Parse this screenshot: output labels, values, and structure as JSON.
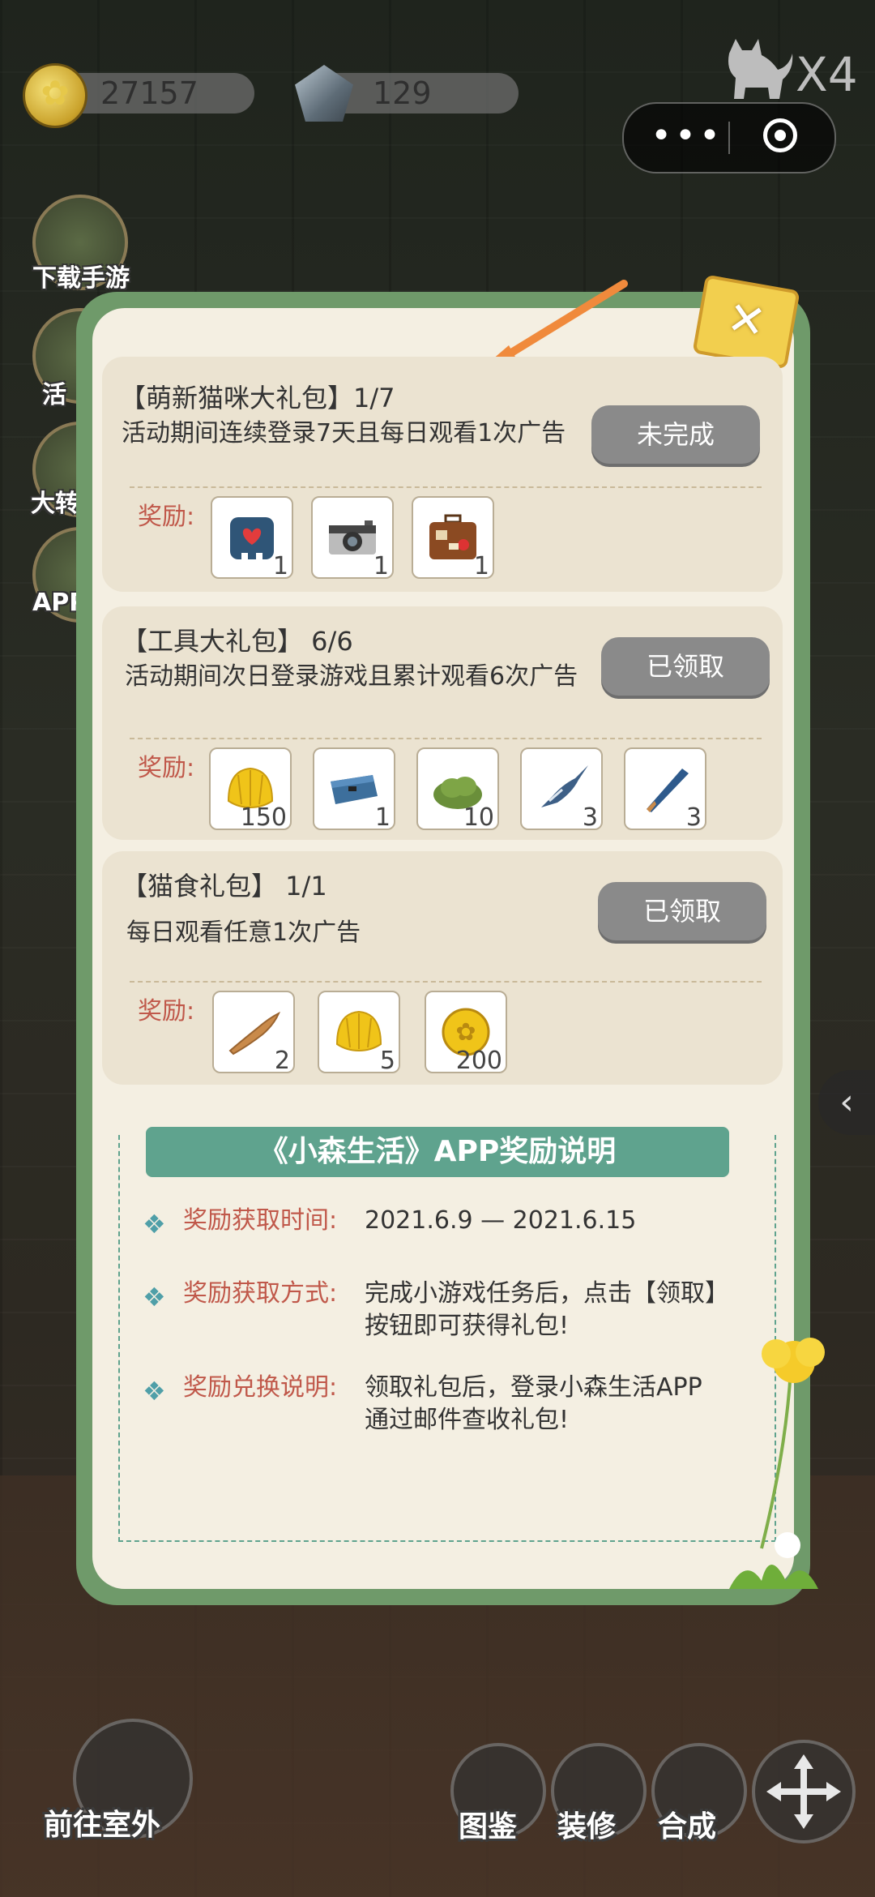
{
  "hud": {
    "coins": "27157",
    "gems": "129",
    "cat_multiplier": "X4"
  },
  "side_menu": [
    "下载手游",
    "活",
    "大转",
    "APP"
  ],
  "panel": {
    "gift_packs": [
      {
        "title": "【萌新猫咪大礼包】1/7",
        "desc": "活动期间连续登录7天且每日观看1次广告",
        "button": "未完成",
        "reward_label": "奖励:",
        "rewards": [
          {
            "icon": "cat-backpack",
            "count": "1"
          },
          {
            "icon": "camera",
            "count": "1"
          },
          {
            "icon": "suitcase",
            "count": "1"
          }
        ]
      },
      {
        "title": "【工具大礼包】 6/6",
        "desc": "活动期间次日登录游戏且累计观看6次广告",
        "button": "已领取",
        "reward_label": "奖励:",
        "rewards": [
          {
            "icon": "gold-shell",
            "count": "150"
          },
          {
            "icon": "toolbox",
            "count": "1"
          },
          {
            "icon": "bush",
            "count": "10"
          },
          {
            "icon": "swordfish",
            "count": "3"
          },
          {
            "icon": "bat",
            "count": "3"
          }
        ]
      },
      {
        "title": "【猫食礼包】  1/1",
        "desc": "每日观看任意1次广告",
        "button": "已领取",
        "reward_label": "奖励:",
        "rewards": [
          {
            "icon": "dried-fish",
            "count": "2"
          },
          {
            "icon": "gold-shell",
            "count": "5"
          },
          {
            "icon": "gold-coin",
            "count": "200"
          }
        ]
      }
    ],
    "info": {
      "banner": "《小森生活》APP奖励说明",
      "rows": [
        {
          "label": "奖励获取时间:",
          "value": "2021.6.9 — 2021.6.15"
        },
        {
          "label": "奖励获取方式:",
          "value": "完成小游戏任务后，点击【领取】按钮即可获得礼包!"
        },
        {
          "label": "奖励兑换说明:",
          "value": "领取礼包后，登录小森生活APP通过邮件查收礼包!"
        }
      ]
    }
  },
  "bottom_bar": {
    "outdoor": "前往室外",
    "catalog": "图鉴",
    "decorate": "装修",
    "combine": "合成"
  }
}
